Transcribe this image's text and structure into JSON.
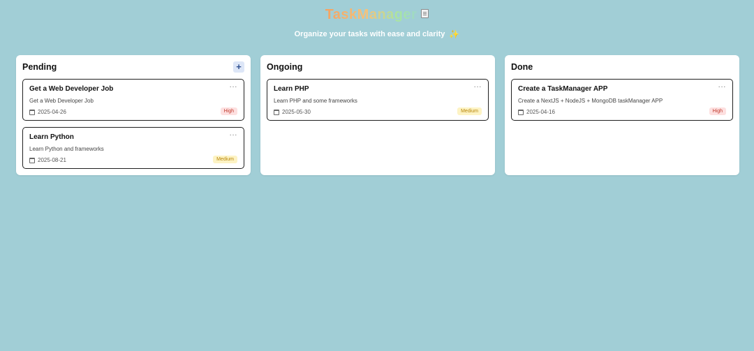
{
  "header": {
    "title": "TaskManager",
    "title_icon": "memo-icon",
    "subtitle": "Organize your tasks with ease and clarity",
    "subtitle_icon": "sparkle-icon"
  },
  "colors": {
    "background": "#a1ced6",
    "priority_high": "#c0392b",
    "priority_medium": "#b8860b"
  },
  "columns": [
    {
      "title": "Pending",
      "add_label": "+",
      "cards": [
        {
          "title": "Get a Web Developer Job",
          "menu": "···",
          "description": "Get a Web Developer Job",
          "date": "2025-04-26",
          "priority": "High"
        },
        {
          "title": "Learn Python",
          "menu": "···",
          "description": "Learn Python and frameworks",
          "date": "2025-08-21",
          "priority": "Medium"
        }
      ]
    },
    {
      "title": "Ongoing",
      "cards": [
        {
          "title": "Learn PHP",
          "menu": "···",
          "description": "Learn PHP and some frameworks",
          "date": "2025-05-30",
          "priority": "Medium"
        }
      ]
    },
    {
      "title": "Done",
      "cards": [
        {
          "title": "Create a TaskManager APP",
          "menu": "···",
          "description": "Create a NextJS + NodeJS + MongoDB taskManager APP",
          "date": "2025-04-16",
          "priority": "High"
        }
      ]
    }
  ]
}
